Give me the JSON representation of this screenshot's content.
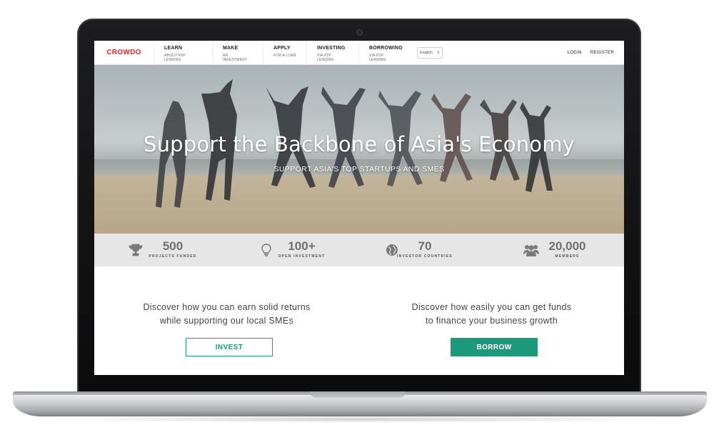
{
  "brand": {
    "logo_text": "CROWDO",
    "accent": "#e4252c",
    "green": "#1c9a7a"
  },
  "nav": {
    "items": [
      {
        "title": "LEARN",
        "sub": "ABOUT P2P LENDING"
      },
      {
        "title": "MAKE",
        "sub": "AN INVESTMENT"
      },
      {
        "title": "APPLY",
        "sub": "FOR A LOAN"
      },
      {
        "title": "INVESTING",
        "sub": "VIA P2P LENDING"
      },
      {
        "title": "BORROWING",
        "sub": "VIA P2P LENDING"
      }
    ],
    "language": "English",
    "login": "LOGIN",
    "register": "REGISTER"
  },
  "hero": {
    "title": "Support the Backbone of Asia's Economy",
    "subtitle": "SUPPORT ASIA'S TOP STARTUPS AND SMES"
  },
  "stats": [
    {
      "icon": "trophy-icon",
      "value": "500",
      "label": "PROJECTS FUNDED"
    },
    {
      "icon": "lightbulb-icon",
      "value": "100+",
      "label": "OPEN INVESTMENT"
    },
    {
      "icon": "globe-icon",
      "value": "70",
      "label": "INVESTOR COUNTRIES"
    },
    {
      "icon": "users-icon",
      "value": "20,000",
      "label": "MEMBERS"
    }
  ],
  "cta": {
    "invest": {
      "line1": "Discover how you can earn solid returns",
      "line2": "while supporting our local SMEs",
      "button": "INVEST"
    },
    "borrow": {
      "line1": "Discover how easily you can get funds",
      "line2": "to finance your business growth",
      "button": "BORROW"
    }
  }
}
